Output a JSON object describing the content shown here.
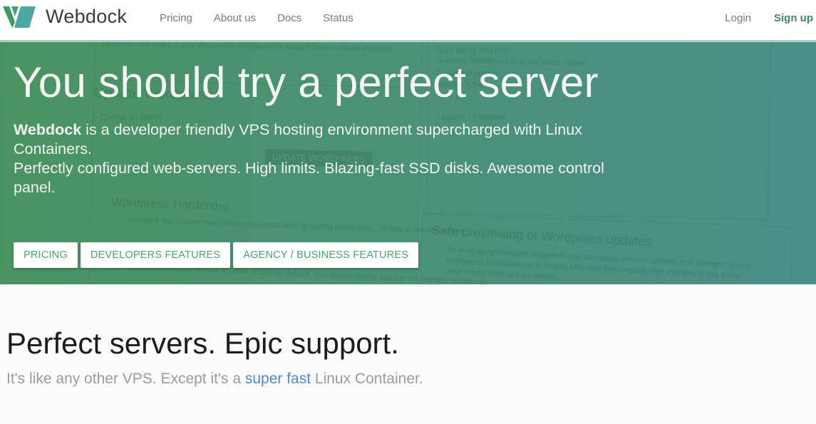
{
  "brand": {
    "name": "Webdock",
    "colors": {
      "logo_dark": "#3b9a6a",
      "logo_light": "#4aa8a0",
      "accent": "#3f8a6a",
      "button_text": "#4aa56a",
      "link_blue": "#4f8ad8"
    }
  },
  "nav": {
    "links": [
      {
        "label": "Pricing"
      },
      {
        "label": "About us"
      },
      {
        "label": "Docs"
      },
      {
        "label": "Status"
      }
    ],
    "login_label": "Login",
    "signup_label": "Sign up"
  },
  "hero": {
    "title": "You should try a perfect server",
    "desc_brand": "Webdock",
    "desc_line1": " is a developer friendly VPS hosting environment supercharged with Linux Containers.",
    "desc_line2": "Perfectly configured web-servers. High limits. Blazing-fast SSD disks. Awesome control panel.",
    "buttons": [
      {
        "label": "PRICING"
      },
      {
        "label": "DEVELOPERS FEATURES"
      },
      {
        "label": "AGENCY / BUSINESS FEATURES"
      }
    ],
    "background_ghost_text": {
      "top_left": "Here you can check if your Wordpress installation or plugins have updates available.",
      "update_heading": "Update Wordpress",
      "choose_option": "Choose an option",
      "update_button": "UPDATE WORDPRESS",
      "hardening_heading": "Wordpress Hardening",
      "hardening_text": "Webdock can harden your Wordpress installation by setting prohibitive... all files in the filesystem.",
      "hardening_text2": "script which is added to your account scripts by default. You should deploy and run the Harden Wordpress",
      "log_time": "2017-08-17 18:17:07",
      "log_success": "Success: WordPress is at the latest version.",
      "log_plugins": "2 installed plugins",
      "log_akismet": "akismet 3.3.4",
      "log_hello": "hello 1.6",
      "legend": "Legend: I = Inactive",
      "preview_heading": "Safe previewing of Wordpress updates",
      "preview_text": "By leveraging Webdock snapshots you can easily perform updates and changes to your Wordpress installation on a staging URL and then migrate your changes to this server once ready. Here are our recom..."
    }
  },
  "section": {
    "title": "Perfect servers. Epic support.",
    "subtitle_before": "It's like any other VPS. Except it's a ",
    "subtitle_highlight": "super fast",
    "subtitle_after": " Linux Container."
  }
}
